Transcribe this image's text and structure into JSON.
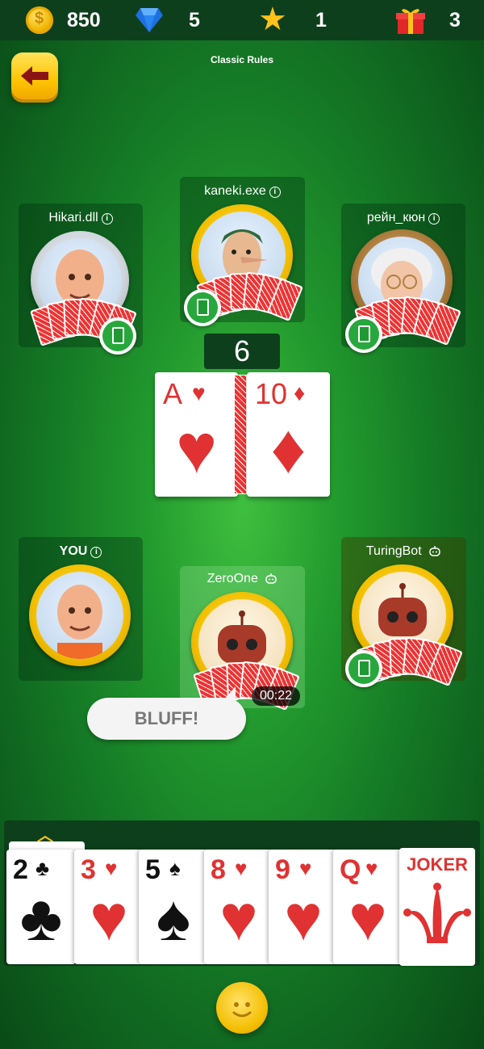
{
  "stats": {
    "coins": "850",
    "gems": "5",
    "stars": "1",
    "gifts": "3"
  },
  "header": {
    "title": "Classic Rules"
  },
  "players": {
    "top_left": {
      "name": "Hikari.dll",
      "frame": "silver"
    },
    "top_center": {
      "name": "kaneki.exe",
      "frame": "gold"
    },
    "top_right": {
      "name": "рейн_кюн",
      "frame": "bronze"
    },
    "you": {
      "name": "YOU",
      "frame": "gold"
    },
    "bottom_center": {
      "name": "ZeroOne",
      "frame": "gold",
      "timer": "00:22"
    },
    "bottom_right": {
      "name": "TuringBot",
      "frame": "gold"
    }
  },
  "pile": {
    "count": "6",
    "cards": [
      {
        "rank": "A",
        "suit": "♥"
      },
      {
        "rank": "10",
        "suit": "♦"
      }
    ]
  },
  "bluff_button": {
    "label": "BLUFF!"
  },
  "hand": [
    {
      "rank": "2",
      "suit": "♣",
      "color": "black"
    },
    {
      "rank": "3",
      "suit": "♥",
      "color": "red"
    },
    {
      "rank": "5",
      "suit": "♠",
      "color": "black"
    },
    {
      "rank": "8",
      "suit": "♥",
      "color": "red"
    },
    {
      "rank": "9",
      "suit": "♥",
      "color": "red"
    },
    {
      "rank": "Q",
      "suit": "♥",
      "color": "red"
    },
    {
      "rank": "JOKER",
      "suit": "",
      "color": "red"
    }
  ],
  "icons": {
    "coin": "coin-icon",
    "gem": "gem-icon",
    "star": "star-icon",
    "gift": "gift-icon",
    "back": "arrow-left-icon",
    "info": "info-icon",
    "bot": "robot-icon",
    "emoji": "smiley-icon"
  },
  "colors": {
    "accent": "#ffc21a",
    "card_red": "#e03232",
    "bar": "#0d3f1c"
  }
}
